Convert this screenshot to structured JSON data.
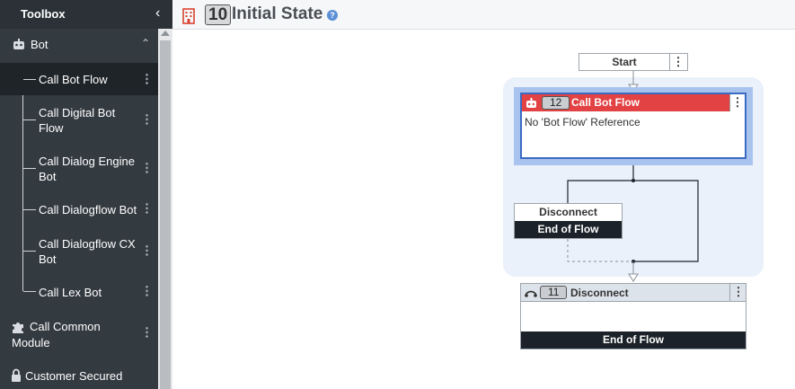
{
  "toolbox": {
    "title": "Toolbox",
    "categories": [
      {
        "label": "Bot",
        "icon": "robot-icon"
      },
      {
        "label": "Call Common Module",
        "icon": "puzzle-icon"
      },
      {
        "label": "Customer Secured",
        "icon": "lock-icon"
      }
    ],
    "items": [
      {
        "label": "Call Bot Flow",
        "active": true
      },
      {
        "label": "Call Digital Bot Flow"
      },
      {
        "label": "Call Dialog Engine Bot"
      },
      {
        "label": "Call Dialogflow Bot"
      },
      {
        "label": "Call Dialogflow CX Bot"
      },
      {
        "label": "Call Lex Bot"
      }
    ]
  },
  "header": {
    "state_number": "10",
    "state_title": "Initial State",
    "help": "?",
    "icon": "building-icon"
  },
  "flow": {
    "start": {
      "label": "Start",
      "menu": "⋮"
    },
    "call_bot_flow": {
      "number": "12",
      "title": "Call Bot Flow",
      "body": "No 'Bot Flow' Reference",
      "icon": "robot-icon",
      "menu": "⋮"
    },
    "disconnect_option": {
      "title": "Disconnect",
      "footer": "End of Flow"
    },
    "disconnect": {
      "number": "11",
      "title": "Disconnect",
      "footer": "End of Flow",
      "icon": "disconnect-icon",
      "menu": "⋮"
    }
  },
  "colors": {
    "sidebar_bg": "#333a40",
    "node_header_red": "#e24243",
    "selection_blue": "#3a6bc2",
    "end_of_flow_bg": "#1c2229"
  }
}
